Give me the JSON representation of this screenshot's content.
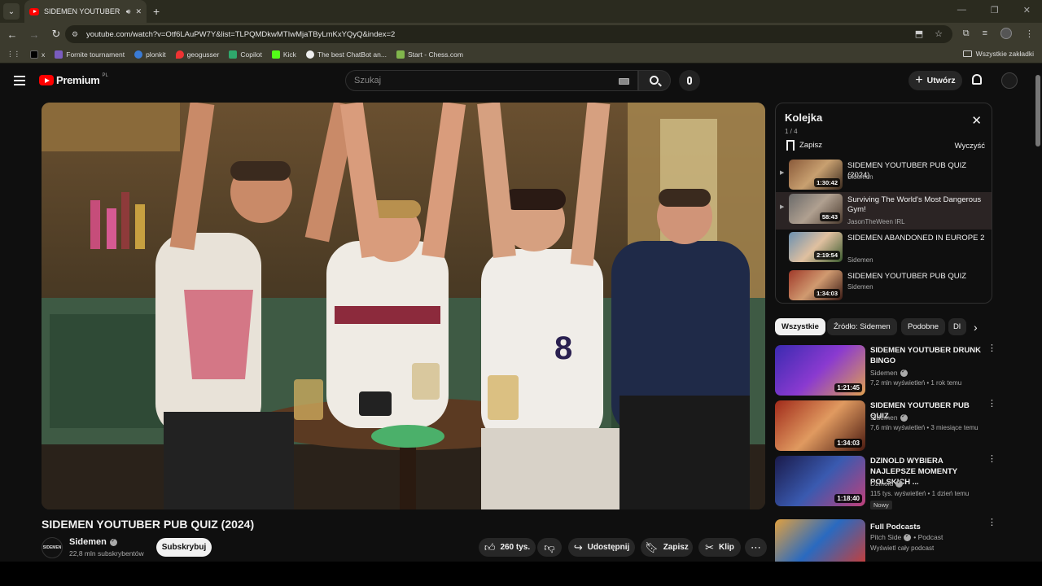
{
  "browser": {
    "tab_title": "SIDEMEN YOUTUBER PUB Q",
    "url": "youtube.com/watch?v=Otf6LAuPW7Y&list=TLPQMDkwMTIwMjaTByLmKxYQyQ&index=2",
    "bookmarks": [
      "x",
      "Fornite tournament",
      "plonkit",
      "geogusser",
      "Copilot",
      "Kick",
      "The best ChatBot an...",
      "Start - Chess.com"
    ],
    "all_bookmarks": "Wszystkie zakładki"
  },
  "header": {
    "logo_text": "Premium",
    "logo_country": "PL",
    "search_placeholder": "Szukaj",
    "create_label": "Utwórz"
  },
  "video": {
    "title": "SIDEMEN YOUTUBER PUB QUIZ (2024)",
    "channel": "Sidemen",
    "channel_logo": "SIDEMEN",
    "subscribers": "22,8 mln subskrybentów",
    "subscribe_label": "Subskrybuj",
    "likes": "260 tys.",
    "share_label": "Udostępnij",
    "save_label": "Zapisz",
    "clip_label": "Klip"
  },
  "queue": {
    "title": "Kolejka",
    "position": "1 / 4",
    "save_label": "Zapisz",
    "clear_label": "Wyczyść",
    "items": [
      {
        "title": "SIDEMEN YOUTUBER PUB QUIZ (2024)",
        "channel": "Sidemen",
        "duration": "1:30:42"
      },
      {
        "title": "Surviving The World's Most Dangerous Gym!",
        "channel": "JasonTheWeen IRL",
        "duration": "58:43"
      },
      {
        "title": "SIDEMEN ABANDONED IN EUROPE 2",
        "channel": "Sidemen",
        "duration": "2:19:54"
      },
      {
        "title": "SIDEMEN YOUTUBER PUB QUIZ",
        "channel": "Sidemen",
        "duration": "1:34:03"
      }
    ]
  },
  "chips": [
    "Wszystkie",
    "Źródło: Sidemen",
    "Podobne",
    "Dl"
  ],
  "recommendations": [
    {
      "title": "SIDEMEN YOUTUBER DRUNK BINGO",
      "channel": "Sidemen",
      "meta": "7,2 mln wyświetleń • 1 rok temu",
      "duration": "1:21:45"
    },
    {
      "title": "SIDEMEN YOUTUBER PUB QUIZ",
      "channel": "Sidemen",
      "meta": "7,6 mln wyświetleń • 3 miesiące temu",
      "duration": "1:34:03"
    },
    {
      "title": "DZINOLD WYBIERA NAJLEPSZE MOMENTY POLSKICH ...",
      "channel": "Dzinold",
      "meta": "115 tys. wyświetleń • 1 dzień temu",
      "duration": "1:18:40",
      "badge": "Nowy"
    },
    {
      "title": "Full Podcasts",
      "channel": "Pitch Side",
      "channel_extra": "• Podcast",
      "meta": "Wyświetl cały podcast"
    }
  ],
  "colors": {
    "brand": "#ff0000",
    "background": "#0f0f0f",
    "chip": "#272727"
  }
}
